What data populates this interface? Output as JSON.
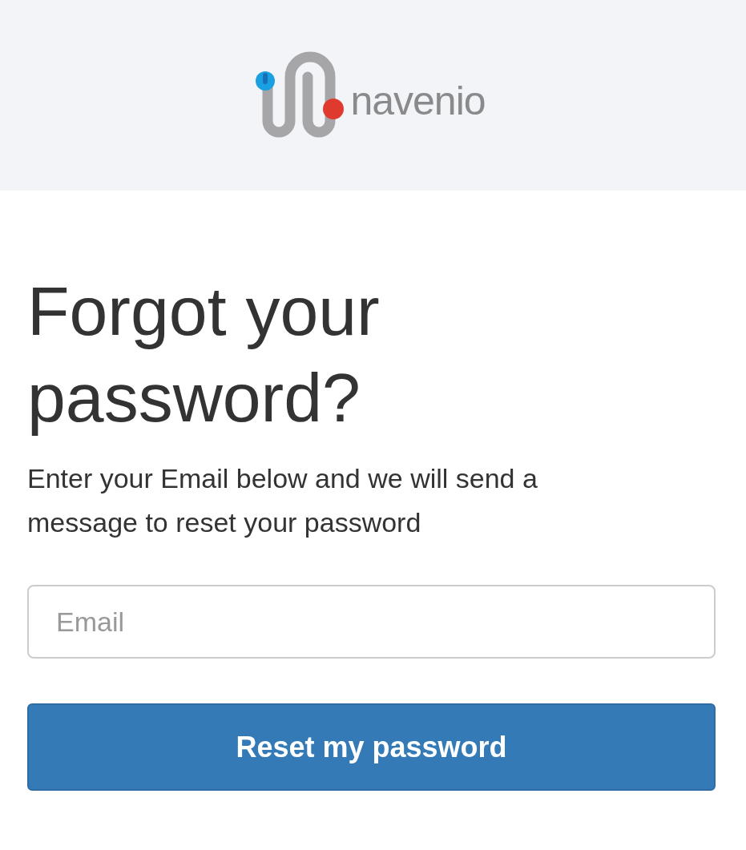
{
  "header": {
    "logo_text": "navenio"
  },
  "title": "Forgot your password?",
  "description": "Enter your Email below and we will send a message to reset your password",
  "email_field": {
    "placeholder": "Email"
  },
  "submit_button": {
    "label": "Reset my password"
  }
}
